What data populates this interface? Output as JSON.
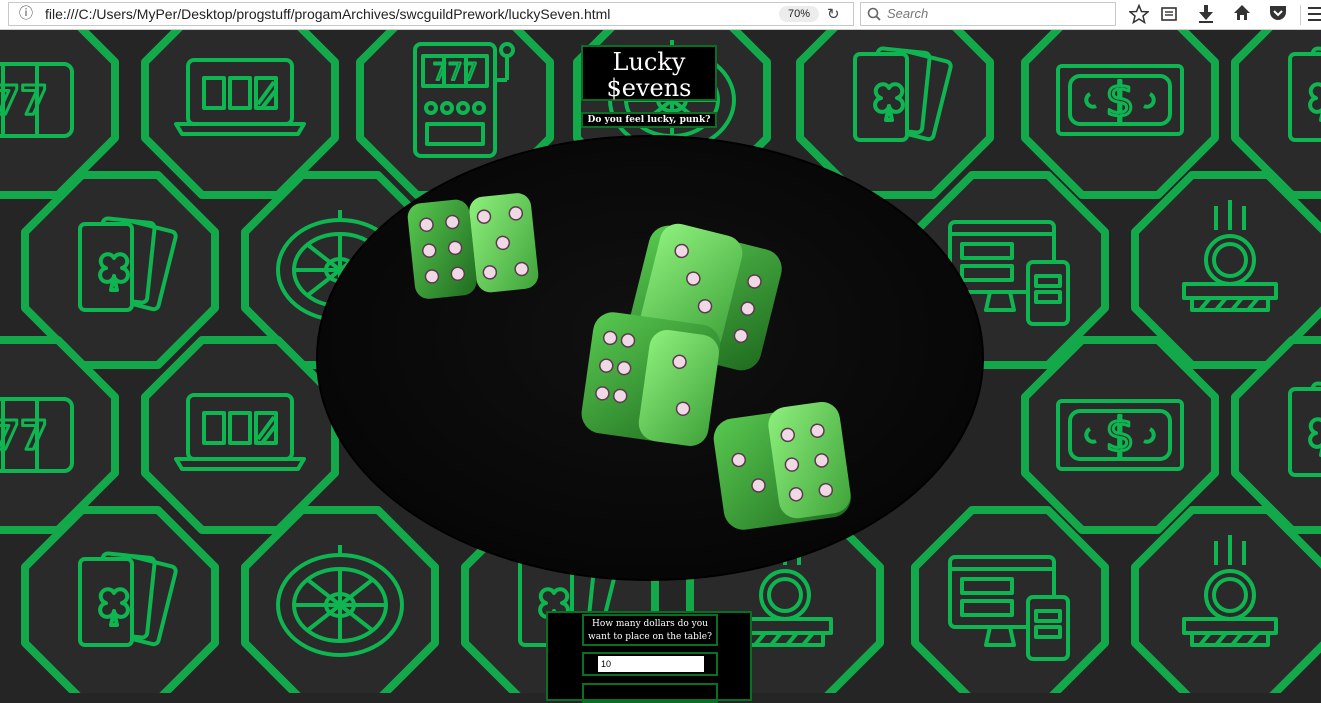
{
  "browser": {
    "url": "file:///C:/Users/MyPer/Desktop/progstuff/progamArchives/swcguildPrework/luckySeven.html",
    "zoom": "70%",
    "search_placeholder": "Search"
  },
  "page": {
    "title_line1": "Lucky",
    "title_line2": "$evens",
    "tagline": "Do you feel lucky, punk?",
    "bet_question": "How many dollars do you want to place on the table?",
    "bet_value": "10"
  },
  "colors": {
    "background": "#252525",
    "hex_outline": "#13a84a",
    "icon_stroke": "#0fb550",
    "panel_border": "#0b6f23",
    "dice": "#5fd85a"
  },
  "background_icons": [
    "slot-77-icon",
    "laptop-slots-icon",
    "slot-machine-icon",
    "cards-icon",
    "dollar-bill-icon",
    "roulette-icon",
    "computer-phone-icon",
    "coin-pusher-icon"
  ]
}
